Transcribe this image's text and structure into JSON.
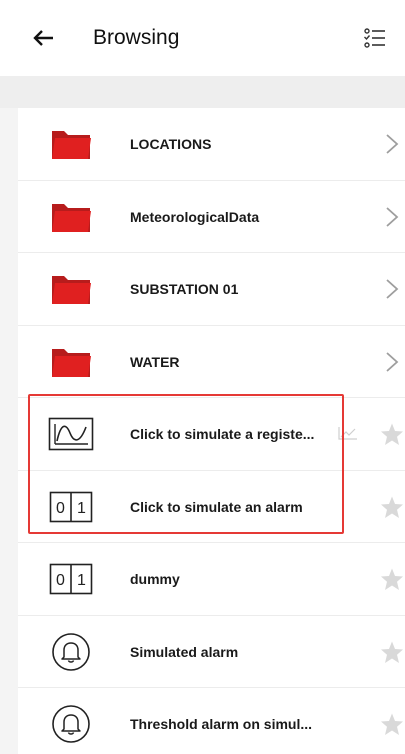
{
  "header": {
    "title": "Browsing",
    "back_icon": "arrow-left-icon",
    "view_icon": "checklist-icon"
  },
  "items": [
    {
      "label": "LOCATIONS",
      "icon": "folder-icon",
      "trailing": "chevron"
    },
    {
      "label": "MeteorologicalData",
      "icon": "folder-icon",
      "trailing": "chevron"
    },
    {
      "label": "SUBSTATION 01",
      "icon": "folder-icon",
      "trailing": "chevron"
    },
    {
      "label": "WATER",
      "icon": "folder-icon",
      "trailing": "chevron"
    },
    {
      "label": "Click to simulate a registe...",
      "icon": "waveform-icon",
      "trailing": "star"
    },
    {
      "label": "Click to simulate an alarm",
      "icon": "binary-icon",
      "trailing": "star"
    },
    {
      "label": "dummy",
      "icon": "binary-icon",
      "trailing": "star"
    },
    {
      "label": "Simulated alarm",
      "icon": "bell-icon",
      "trailing": "star"
    },
    {
      "label": "Threshold alarm on simul...",
      "icon": "bell-icon",
      "trailing": "star"
    }
  ],
  "binary_icon_text": {
    "zero": "0",
    "one": "1"
  },
  "colors": {
    "folder": "#e02020",
    "highlight": "#e53935",
    "chevron": "#9e9e9e",
    "star": "#d9d9d9"
  }
}
